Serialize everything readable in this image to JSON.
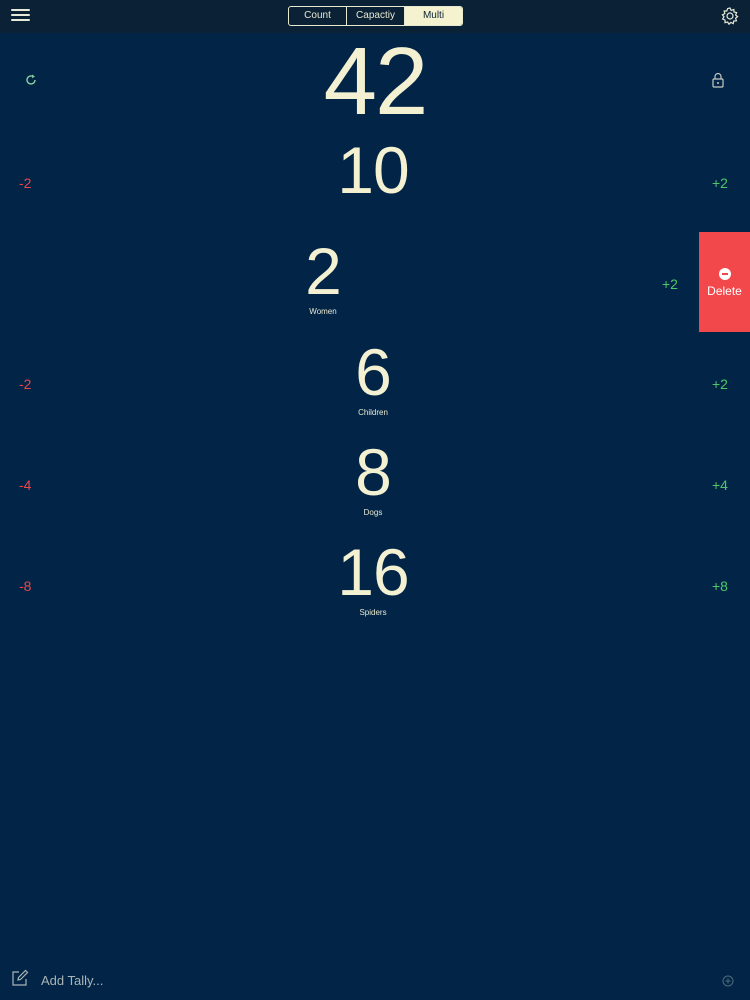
{
  "header": {
    "tabs": [
      {
        "label": "Count",
        "active": false
      },
      {
        "label": "Capactiy",
        "active": false
      },
      {
        "label": "Multi",
        "active": true
      }
    ]
  },
  "total": {
    "value": "42"
  },
  "tallies": [
    {
      "value": "10",
      "label": "",
      "minus": "-2",
      "plus": "+2"
    },
    {
      "value": "2",
      "label": "Women",
      "minus": "",
      "plus": "+2"
    },
    {
      "value": "6",
      "label": "Children",
      "minus": "-2",
      "plus": "+2"
    },
    {
      "value": "8",
      "label": "Dogs",
      "minus": "-4",
      "plus": "+4"
    },
    {
      "value": "16",
      "label": "Spiders",
      "minus": "-8",
      "plus": "+8"
    }
  ],
  "swipe_action": {
    "label": "Delete"
  },
  "footer": {
    "add_tally_label": "Add Tally..."
  },
  "colors": {
    "background": "#022547",
    "topbar": "#0b2236",
    "number": "#f3f1d2",
    "decrement": "#e8474c",
    "increment": "#4bc96a",
    "delete": "#f2484c"
  },
  "icons": [
    "menu-icon",
    "gear-icon",
    "reset-icon",
    "lock-icon",
    "minus-circle-icon",
    "compose-icon",
    "plus-circle-icon"
  ]
}
